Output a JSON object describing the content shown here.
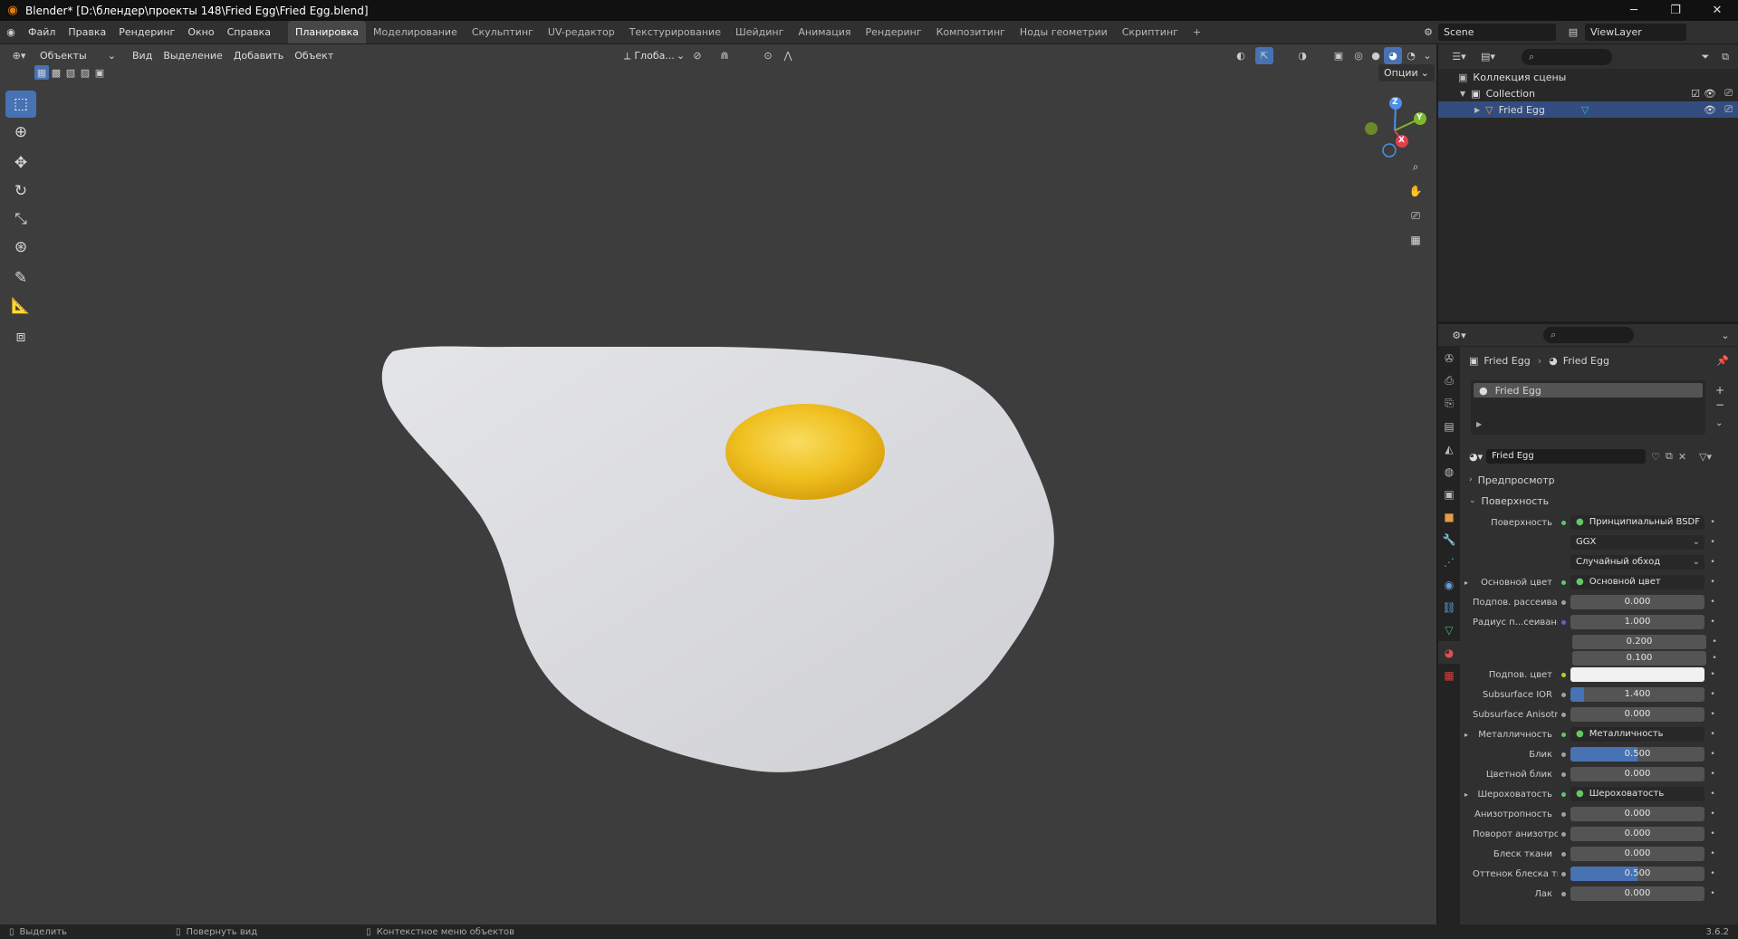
{
  "window": {
    "title": "Blender* [D:\\блендер\\проекты 148\\Fried Egg\\Fried Egg.blend]",
    "minimize": "─",
    "maximize": "❐",
    "close": "✕"
  },
  "topbar": {
    "menus": [
      "Файл",
      "Правка",
      "Рендеринг",
      "Окно",
      "Справка"
    ],
    "workspaces": [
      "Планировка",
      "Моделирование",
      "Скульптинг",
      "UV-редактор",
      "Текстурирование",
      "Шейдинг",
      "Анимация",
      "Рендеринг",
      "Композитинг",
      "Ноды геометрии",
      "Скриптинг"
    ],
    "active_workspace": "Планировка",
    "add_workspace": "+",
    "scene": "Scene",
    "view_layer": "ViewLayer"
  },
  "viewport": {
    "mode": "Объекты",
    "menus": [
      "Вид",
      "Выделение",
      "Добавить",
      "Объект"
    ],
    "transform_orientation": "Глоба...",
    "options": "Опции",
    "gizmo": {
      "x": "X",
      "y": "Y",
      "z": "Z"
    },
    "colors": {
      "background": "#3d3d3d",
      "egg_white": "#dcdde0",
      "yolk": "#f0c020",
      "active_tool": "#4772b3"
    }
  },
  "toolbar": {
    "tools": [
      "select-box-icon",
      "cursor-icon",
      "move-icon",
      "rotate-icon",
      "scale-icon",
      "transform-icon",
      "annotate-icon",
      "measure-icon",
      "add-cube-icon"
    ]
  },
  "outliner": {
    "search_placeholder": "",
    "scene_collection": "Коллекция сцены",
    "collection": "Collection",
    "object": "Fried Egg"
  },
  "properties": {
    "breadcrumb_object": "Fried Egg",
    "breadcrumb_material": "Fried Egg",
    "slot": "Fried Egg",
    "material_name": "Fried Egg",
    "panel_preview": "Предпросмотр",
    "panel_surface": "Поверхность",
    "rows": [
      {
        "label": "Поверхность",
        "value": "Принципиальный BSDF",
        "kind": "link"
      },
      {
        "label": "",
        "value": "GGX",
        "kind": "dropdown"
      },
      {
        "label": "",
        "value": "Случайный обход",
        "kind": "dropdown"
      },
      {
        "label": "Основной цвет",
        "value": "Основной цвет",
        "kind": "link",
        "expand": "▸"
      },
      {
        "label": "Подпов. рассеива...",
        "value": "0.000",
        "kind": "num"
      },
      {
        "label": "Радиус п...сеивания",
        "value": "1.000",
        "kind": "num"
      },
      {
        "label": "",
        "value": "0.200",
        "kind": "num"
      },
      {
        "label": "",
        "value": "0.100",
        "kind": "num"
      },
      {
        "label": "Подпов. цвет",
        "value": "",
        "kind": "color"
      },
      {
        "label": "Subsurface IOR",
        "value": "1.400",
        "kind": "num",
        "fill": 0.1
      },
      {
        "label": "Subsurface Anisotr...",
        "value": "0.000",
        "kind": "num"
      },
      {
        "label": "Металличность",
        "value": "Металличность",
        "kind": "link",
        "expand": "▸"
      },
      {
        "label": "Блик",
        "value": "0.500",
        "kind": "num",
        "fill": 0.5
      },
      {
        "label": "Цветной блик",
        "value": "0.000",
        "kind": "num"
      },
      {
        "label": "Шероховатость",
        "value": "Шероховатость",
        "kind": "link",
        "expand": "▸"
      },
      {
        "label": "Анизотропность",
        "value": "0.000",
        "kind": "num"
      },
      {
        "label": "Поворот анизотро...",
        "value": "0.000",
        "kind": "num"
      },
      {
        "label": "Блеск ткани",
        "value": "0.000",
        "kind": "num"
      },
      {
        "label": "Оттенок блеска тк...",
        "value": "0.500",
        "kind": "num",
        "fill": 0.5
      },
      {
        "label": "Лак",
        "value": "0.000",
        "kind": "num"
      }
    ]
  },
  "statusbar": {
    "select": "Выделить",
    "rotate": "Повернуть вид",
    "context": "Контекстное меню объектов",
    "version": "3.6.2"
  }
}
